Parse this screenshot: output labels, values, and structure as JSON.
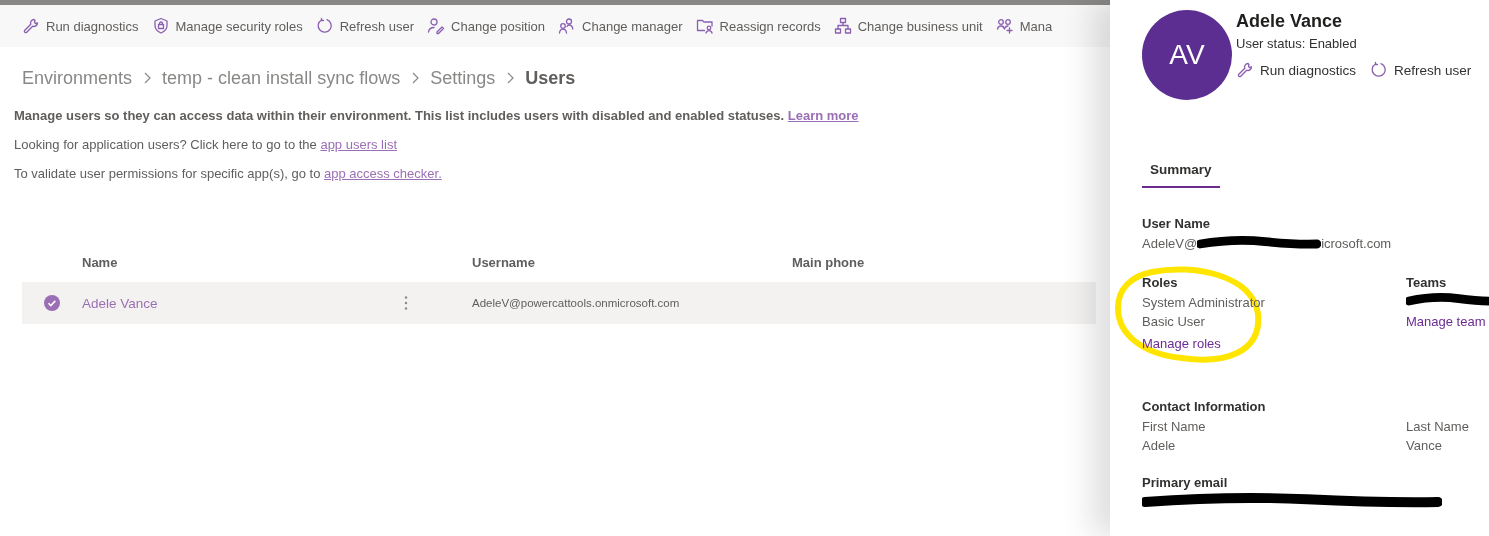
{
  "toolbar": [
    {
      "label": "Run diagnostics"
    },
    {
      "label": "Manage security roles"
    },
    {
      "label": "Refresh user"
    },
    {
      "label": "Change position"
    },
    {
      "label": "Change manager"
    },
    {
      "label": "Reassign records"
    },
    {
      "label": "Change business unit"
    },
    {
      "label": "Mana"
    }
  ],
  "breadcrumb": [
    {
      "label": "Environments",
      "current": false
    },
    {
      "label": "temp - clean install sync flows",
      "current": false
    },
    {
      "label": "Settings",
      "current": false
    },
    {
      "label": "Users",
      "current": true
    }
  ],
  "intro": {
    "text": "Manage users so they can access data within their environment. This list includes users with disabled and enabled statuses.",
    "link": "Learn more"
  },
  "app_users": {
    "text": "Looking for application users? Click here to go to the",
    "link": "app users list"
  },
  "access_checker": {
    "text": "To validate user permissions for specific app(s), go to",
    "link": "app access checker."
  },
  "table": {
    "columns": [
      "Name",
      "Username",
      "Main phone"
    ],
    "rows": [
      {
        "name": "Adele Vance",
        "username": "AdeleV@powercattools.onmicrosoft.com",
        "selected": true
      }
    ]
  },
  "panel": {
    "initials": "AV",
    "name": "Adele Vance",
    "status": "User status: Enabled",
    "actions": [
      "Run diagnostics",
      "Refresh user"
    ],
    "tabs": [
      {
        "label": "Summary",
        "selected": true
      }
    ],
    "user_name": {
      "label": "User Name",
      "value_start": "AdeleV@",
      "value_end": "icrosoft.com"
    },
    "roles": {
      "label": "Roles",
      "items": [
        "System Administrator",
        "Basic User"
      ],
      "link": "Manage roles"
    },
    "teams": {
      "label": "Teams",
      "link": "Manage team"
    },
    "contact": {
      "title": "Contact Information",
      "fields": [
        {
          "label": "First Name",
          "value": "Adele"
        },
        {
          "label": "Last Name",
          "value": "Vance"
        }
      ]
    },
    "primary_email": {
      "label": "Primary email"
    }
  }
}
